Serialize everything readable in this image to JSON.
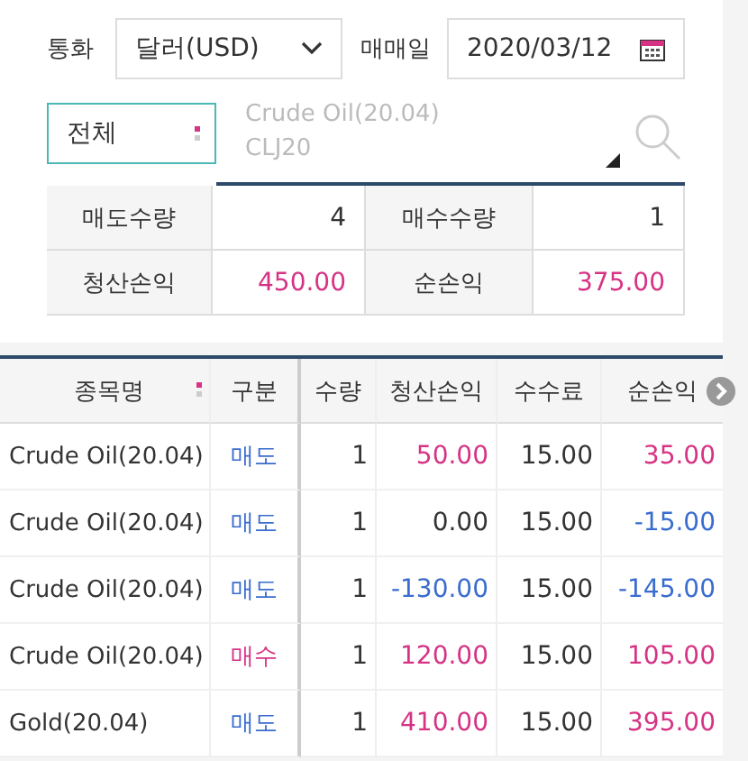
{
  "currency": {
    "label": "통화",
    "value": "달러(USD)"
  },
  "date": {
    "label": "매매일",
    "value": "2020/03/12"
  },
  "filter": {
    "value": "전체"
  },
  "product": {
    "name": "Crude Oil(20.04)",
    "code": "CLJ20"
  },
  "summary": [
    {
      "label": "매도수량",
      "value": "4",
      "color": "#333333"
    },
    {
      "label": "매수수량",
      "value": "1",
      "color": "#333333"
    },
    {
      "label": "청산손익",
      "value": "450.00",
      "color": "#d63384"
    },
    {
      "label": "순손익",
      "value": "375.00",
      "color": "#d63384"
    }
  ],
  "table": {
    "columns": [
      "종목명",
      "구분",
      "수량",
      "청산손익",
      "수수료",
      "순손익"
    ],
    "rows": [
      {
        "name": "Crude Oil(20.04)",
        "side": {
          "text": "매도",
          "color": "#3a6ccf"
        },
        "qty": "1",
        "pnl": {
          "text": "50.00",
          "color": "#d63384"
        },
        "fee": "15.00",
        "net": {
          "text": "35.00",
          "color": "#d63384"
        }
      },
      {
        "name": "Crude Oil(20.04)",
        "side": {
          "text": "매도",
          "color": "#3a6ccf"
        },
        "qty": "1",
        "pnl": {
          "text": "0.00",
          "color": "#333333"
        },
        "fee": "15.00",
        "net": {
          "text": "-15.00",
          "color": "#3a6ccf"
        }
      },
      {
        "name": "Crude Oil(20.04)",
        "side": {
          "text": "매도",
          "color": "#3a6ccf"
        },
        "qty": "1",
        "pnl": {
          "text": "-130.00",
          "color": "#3a6ccf"
        },
        "fee": "15.00",
        "net": {
          "text": "-145.00",
          "color": "#3a6ccf"
        }
      },
      {
        "name": "Crude Oil(20.04)",
        "side": {
          "text": "매수",
          "color": "#d63384"
        },
        "qty": "1",
        "pnl": {
          "text": "120.00",
          "color": "#d63384"
        },
        "fee": "15.00",
        "net": {
          "text": "105.00",
          "color": "#d63384"
        }
      },
      {
        "name": "Gold(20.04)",
        "side": {
          "text": "매도",
          "color": "#3a6ccf"
        },
        "qty": "1",
        "pnl": {
          "text": "410.00",
          "color": "#d63384"
        },
        "fee": "15.00",
        "net": {
          "text": "395.00",
          "color": "#d63384"
        }
      }
    ]
  }
}
